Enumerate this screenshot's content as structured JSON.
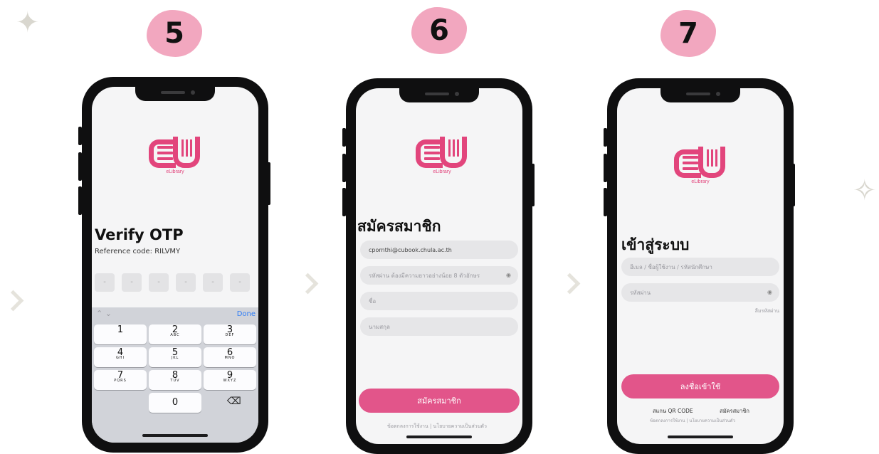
{
  "steps": [
    {
      "number": "5"
    },
    {
      "number": "6"
    },
    {
      "number": "7"
    }
  ],
  "logo_caption": "eLibrary",
  "screen5": {
    "title": "Verify OTP",
    "reference": "Reference code: RILVMY",
    "otp_boxes": [
      "-",
      "-",
      "-",
      "-",
      "-",
      "-"
    ],
    "done_label": "Done",
    "keys": [
      {
        "num": "1",
        "letters": ""
      },
      {
        "num": "2",
        "letters": "ABC"
      },
      {
        "num": "3",
        "letters": "DEF"
      },
      {
        "num": "4",
        "letters": "GHI"
      },
      {
        "num": "5",
        "letters": "JKL"
      },
      {
        "num": "6",
        "letters": "MNO"
      },
      {
        "num": "7",
        "letters": "PQRS"
      },
      {
        "num": "8",
        "letters": "TUV"
      },
      {
        "num": "9",
        "letters": "WXYZ"
      },
      {
        "num": "0",
        "letters": ""
      }
    ],
    "delete_glyph": "⌫"
  },
  "screen6": {
    "title": "สมัครสมาชิก",
    "email_value": "cpornthi@cubook.chula.ac.th",
    "password_placeholder": "รหัสผ่าน ต้องมีความยาวอย่างน้อย 8 ตัวอักษร",
    "name_placeholder": "ชื่อ",
    "surname_placeholder": "นามสกุล",
    "submit_label": "สมัครสมาชิก",
    "footer_left": "ข้อตกลงการใช้งาน",
    "footer_sep": "|",
    "footer_right": "นโยบายความเป็นส่วนตัว"
  },
  "screen7": {
    "title": "เข้าสู่ระบบ",
    "username_placeholder": "อีเมล / ชื่อผู้ใช้งาน / รหัสนักศึกษา",
    "password_placeholder": "รหัสผ่าน",
    "forgot_label": "ลืมรหัสผ่าน",
    "login_label": "ลงชื่อเข้าใช้",
    "qr_label": "สแกน QR CODE",
    "register_label": "สมัครสมาชิก",
    "footer_left": "ข้อตกลงการใช้งาน",
    "footer_sep": "|",
    "footer_right": "นโยบายความเป็นส่วนตัว"
  }
}
